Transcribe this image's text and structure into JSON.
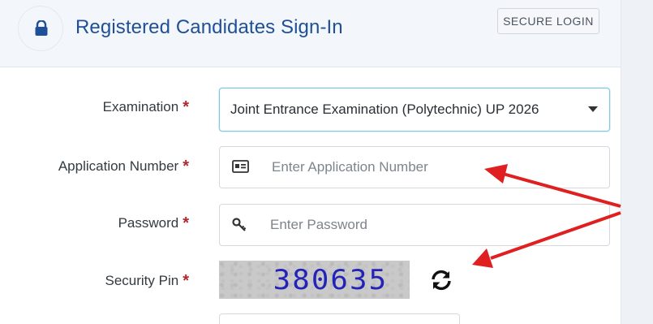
{
  "header": {
    "title": "Registered Candidates Sign-In",
    "badge": "SECURE LOGIN"
  },
  "form": {
    "examination": {
      "label": "Examination",
      "required_mark": "*",
      "selected": "Joint Entrance Examination (Polytechnic) UP 2026"
    },
    "application_number": {
      "label": "Application Number",
      "required_mark": "*",
      "placeholder": "Enter Application Number",
      "value": ""
    },
    "password": {
      "label": "Password",
      "required_mark": "*",
      "placeholder": "Enter Password",
      "value": ""
    },
    "security_pin": {
      "label": "Security Pin",
      "required_mark": "*",
      "captcha_text": "380635"
    }
  },
  "icons": {
    "header": "lock-icon",
    "application_number": "id-card-icon",
    "password": "key-icon",
    "captcha_refresh": "refresh-icon"
  },
  "colors": {
    "title": "#1f4f96",
    "required": "#b3282d",
    "focus_border": "#7ec8e3",
    "annotation_arrow": "#e02020",
    "captcha_text": "#2323b8"
  }
}
